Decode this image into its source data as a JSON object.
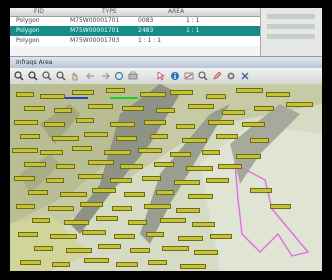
{
  "table": {
    "headers": [
      "",
      "FID",
      "TYPE",
      "AREA",
      ""
    ],
    "rows": [
      {
        "type": "Polygon",
        "id": "M75W00001701",
        "value": "0083",
        "extra": "1 : 1",
        "selected": false
      },
      {
        "type": "Polygon",
        "id": "M75W00001701",
        "value": "2483",
        "extra": "1 : 1",
        "selected": true
      },
      {
        "type": "Polygon",
        "id": "M75W00001703",
        "value": "1 : 1 : 1",
        "extra": "",
        "selected": false
      }
    ]
  },
  "map_window": {
    "title": "Infraqs Area"
  },
  "toolbar": {
    "icons": [
      "zoom-in-icon",
      "zoom-out-icon",
      "zoom-in-icon",
      "zoom-out-icon",
      "pan-icon",
      "back-icon",
      "forward-icon",
      "refresh-icon",
      "print-icon",
      "select-icon",
      "info-icon",
      "measure-icon",
      "search-icon",
      "edit-icon",
      "settings-icon",
      "close-icon"
    ]
  },
  "map": {
    "boundary_color": "#e070e0",
    "scale_bar_colors": [
      "#2b3fc0",
      "#19d026"
    ],
    "label_color": "#c5c235"
  }
}
